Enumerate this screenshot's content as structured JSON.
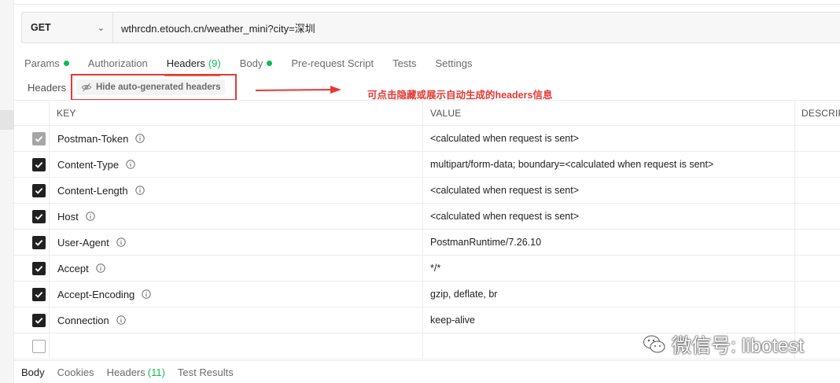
{
  "request": {
    "method": "GET",
    "url": "wthrcdn.etouch.cn/weather_mini?city=深圳"
  },
  "tabs": [
    {
      "label": "Params",
      "count": "",
      "dot": true
    },
    {
      "label": "Authorization",
      "count": "",
      "dot": false
    },
    {
      "label": "Headers",
      "count": "(9)",
      "dot": false
    },
    {
      "label": "Body",
      "count": "",
      "dot": true
    },
    {
      "label": "Pre-request Script",
      "count": "",
      "dot": false
    },
    {
      "label": "Tests",
      "count": "",
      "dot": false
    },
    {
      "label": "Settings",
      "count": "",
      "dot": false
    }
  ],
  "headers_section": {
    "label": "Headers",
    "toggle_label": "Hide auto-generated headers",
    "annotation": "可点击隐藏或展示自动生成的headers信息"
  },
  "table": {
    "columns": [
      "KEY",
      "VALUE",
      "DESCRIP"
    ],
    "rows": [
      {
        "key": "Postman-Token",
        "value": "<calculated when request is sent>",
        "checked": true,
        "disabled": true
      },
      {
        "key": "Content-Type",
        "value": "multipart/form-data; boundary=<calculated when request is sent>",
        "checked": true,
        "disabled": false
      },
      {
        "key": "Content-Length",
        "value": "<calculated when request is sent>",
        "checked": true,
        "disabled": false
      },
      {
        "key": "Host",
        "value": "<calculated when request is sent>",
        "checked": true,
        "disabled": false
      },
      {
        "key": "User-Agent",
        "value": "PostmanRuntime/7.26.10",
        "checked": true,
        "disabled": false
      },
      {
        "key": "Accept",
        "value": "*/*",
        "checked": true,
        "disabled": false
      },
      {
        "key": "Accept-Encoding",
        "value": "gzip, deflate, br",
        "checked": true,
        "disabled": false
      },
      {
        "key": "Connection",
        "value": "keep-alive",
        "checked": true,
        "disabled": false
      }
    ]
  },
  "response_tabs": [
    {
      "label": "Body",
      "count": ""
    },
    {
      "label": "Cookies",
      "count": ""
    },
    {
      "label": "Headers",
      "count": "(11)"
    },
    {
      "label": "Test Results",
      "count": ""
    }
  ],
  "watermark": "微信号: libotest",
  "colors": {
    "accent": "#f26b3a",
    "success": "#0cbb52",
    "annotation": "#e53935"
  },
  "icons": [
    "chevron-down-icon",
    "eye-slash-icon",
    "info-icon",
    "checkbox-icon",
    "wechat-icon"
  ]
}
